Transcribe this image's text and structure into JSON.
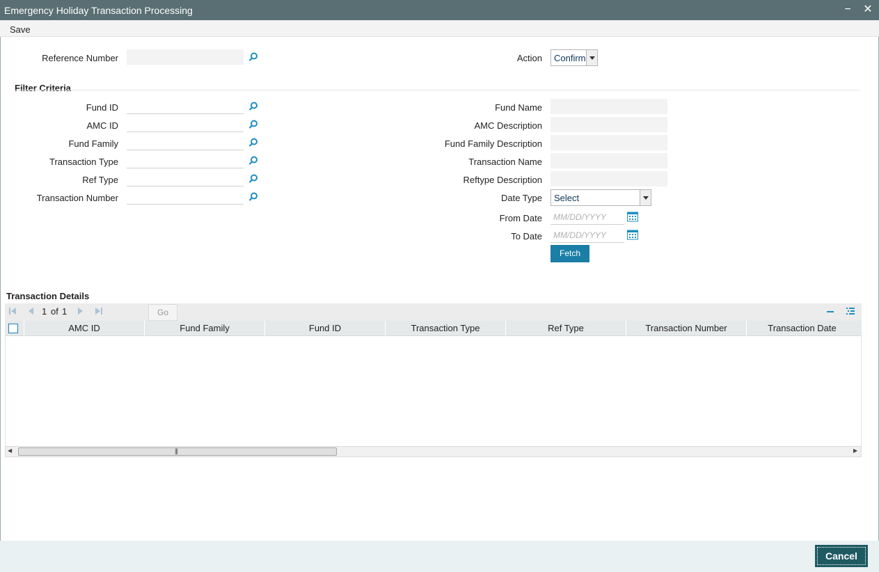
{
  "window": {
    "title": "Emergency Holiday Transaction Processing",
    "minimize_glyph": "−",
    "close_glyph": "✕"
  },
  "menu": {
    "save_label": "Save"
  },
  "header": {
    "reference_number_label": "Reference Number",
    "reference_number_value": "",
    "action_label": "Action",
    "action_value": "Confirm"
  },
  "filter": {
    "section_title": "Filter Criteria",
    "left_fields": [
      {
        "label": "Fund ID",
        "value": ""
      },
      {
        "label": "AMC ID",
        "value": ""
      },
      {
        "label": "Fund Family",
        "value": ""
      },
      {
        "label": "Transaction Type",
        "value": ""
      },
      {
        "label": "Ref Type",
        "value": ""
      },
      {
        "label": "Transaction Number",
        "value": ""
      }
    ],
    "right_fields": [
      {
        "label": "Fund Name",
        "value": ""
      },
      {
        "label": "AMC Description",
        "value": ""
      },
      {
        "label": "Fund Family Description",
        "value": ""
      },
      {
        "label": "Transaction Name",
        "value": ""
      },
      {
        "label": "Reftype Description",
        "value": ""
      }
    ],
    "date_type_label": "Date Type",
    "date_type_value": "Select",
    "from_date_label": "From Date",
    "from_date_placeholder": "MM/DD/YYYY",
    "to_date_label": "To Date",
    "to_date_placeholder": "MM/DD/YYYY",
    "fetch_label": "Fetch"
  },
  "grid": {
    "section_title": "Transaction Details",
    "page_current": "1",
    "page_of": "of",
    "page_total": "1",
    "go_label": "Go",
    "columns": [
      "AMC ID",
      "Fund Family",
      "Fund ID",
      "Transaction Type",
      "Ref Type",
      "Transaction Number",
      "Transaction Date"
    ],
    "rows": []
  },
  "footer": {
    "cancel_label": "Cancel"
  },
  "colors": {
    "titlebar": "#5a6f73",
    "accent": "#1a7ea6",
    "cancel": "#1f5a63",
    "lookup_icon": "#1d8ec2"
  },
  "icons": [
    "search-icon",
    "calendar-icon",
    "first-page-icon",
    "prev-page-icon",
    "next-page-icon",
    "last-page-icon",
    "collapse-icon",
    "column-settings-icon"
  ]
}
